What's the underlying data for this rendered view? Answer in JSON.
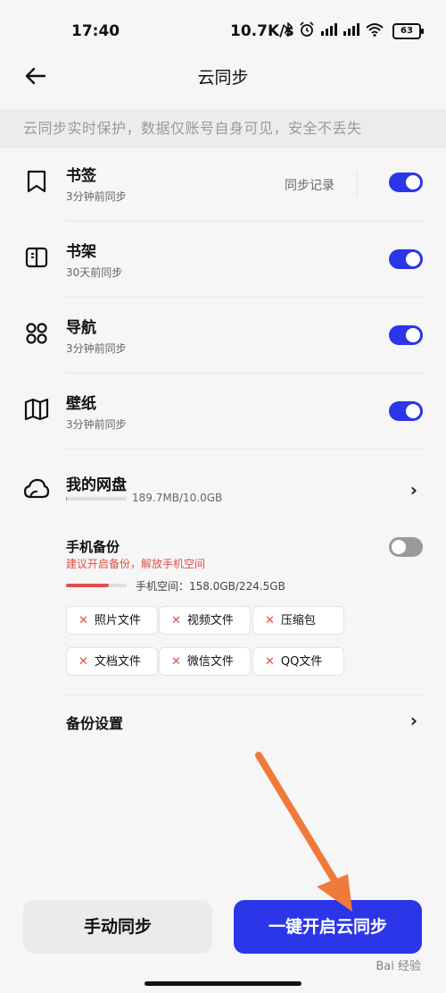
{
  "status_bar": {
    "time": "17:40",
    "net_speed": "10.7K/s",
    "battery": "63"
  },
  "header": {
    "title": "云同步"
  },
  "banner": {
    "text": "云同步实时保护，数据仅账号自身可见，安全不丢失"
  },
  "sync_items": [
    {
      "name": "书签",
      "status": "3分钟前同步",
      "enabled": true,
      "icon": "bookmark-icon"
    },
    {
      "name": "书架",
      "status": "30天前同步",
      "enabled": true,
      "icon": "bookshelf-icon"
    },
    {
      "name": "导航",
      "status": "3分钟前同步",
      "enabled": true,
      "icon": "grid-icon"
    },
    {
      "name": "壁纸",
      "status": "3分钟前同步",
      "enabled": true,
      "icon": "map-icon"
    }
  ],
  "sync_record_label": "同步记录",
  "cloud_drive": {
    "title": "我的网盘",
    "usage": "189.7MB/10.0GB",
    "usage_fraction": 0.02,
    "icon": "cloud-icon"
  },
  "phone_backup": {
    "title": "手机备份",
    "hint": "建议开启备份，解放手机空间",
    "enabled": false,
    "storage_label": "手机空间：158.0GB/224.5GB",
    "storage_fraction": 0.7,
    "chips": [
      "照片文件",
      "视频文件",
      "压缩包",
      "文档文件",
      "微信文件",
      "QQ文件"
    ]
  },
  "backup_settings": {
    "label": "备份设置"
  },
  "buttons": {
    "manual": "手动同步",
    "one_click": "一键开启云同步"
  },
  "watermark": "Bai 经验",
  "colors": {
    "accent": "#2b36e8",
    "warning": "#e0504a",
    "annotation_arrow": "#f07a3a"
  }
}
